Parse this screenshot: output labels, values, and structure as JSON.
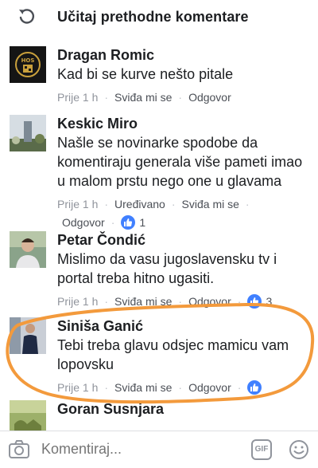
{
  "load_more": {
    "label": "Učitaj prethodne komentare"
  },
  "comments": [
    {
      "author": "Dragan Romic",
      "text": [
        "Kad bi se kurve nešto pitale"
      ],
      "time": "Prije 1 h",
      "like_label": "Sviđa mi se",
      "reply_label": "Odgovor",
      "edited_label": "",
      "reactions": ""
    },
    {
      "author": "Keskic Miro",
      "text": [
        "Našle se novinarke spodobe da",
        "komentiraju generala više pameti imao",
        "u malom prstu nego one u glavama"
      ],
      "time": "Prije 1 h",
      "edited_label": "Uređivano",
      "like_label": "Sviđa mi se",
      "reply_label": "Odgovor",
      "reactions": "1"
    },
    {
      "author": "Petar Čondić",
      "text": [
        "Mislimo da vasu jugoslavensku tv i",
        "portal treba hitno ugasiti."
      ],
      "time": "Prije 1 h",
      "like_label": "Sviđa mi se",
      "reply_label": "Odgovor",
      "edited_label": "",
      "reactions": "3"
    },
    {
      "author": "Siniša Ganić",
      "text": [
        "Tebi treba glavu odsjec mamicu vam",
        "lopovsku"
      ],
      "time": "Prije 1 h",
      "like_label": "Sviđa mi se",
      "reply_label": "Odgovor",
      "edited_label": "",
      "reactions": ""
    },
    {
      "author": "Goran Susnjara",
      "text": [],
      "time": "",
      "like_label": "",
      "reply_label": "",
      "edited_label": "",
      "reactions": ""
    }
  ],
  "composer": {
    "placeholder": "Komentiraj...",
    "gif_label": "GIF"
  },
  "colors": {
    "accent_blue": "#4080ff",
    "annotation_orange": "#f39a3c",
    "meta_gray": "#90949c"
  },
  "icons": [
    "undo-arrow-icon",
    "like-thumb-icon",
    "camera-icon",
    "gif-icon",
    "smiley-icon"
  ]
}
